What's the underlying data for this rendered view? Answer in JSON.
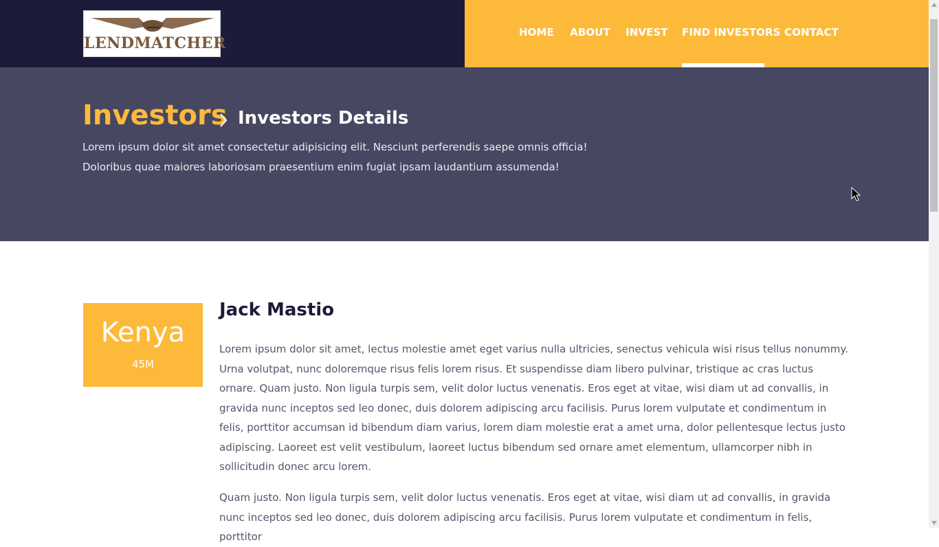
{
  "header": {
    "logo_text": "LENDMATCHER",
    "nav": [
      {
        "label": "HOME"
      },
      {
        "label": "ABOUT"
      },
      {
        "label": "INVEST"
      },
      {
        "label": "FIND INVESTORS",
        "active": true
      },
      {
        "label": "CONTACT"
      }
    ]
  },
  "banner": {
    "breadcrumb_main": "Investors",
    "breadcrumb_sub": "Investors Details",
    "description": "Lorem ipsum dolor sit amet consectetur adipisicing elit. Nesciunt perferendis saepe omnis officia! Doloribus quae maiores laboriosam praesentium enim fugiat ipsam laudantium assumenda!"
  },
  "investor": {
    "country": "Kenya",
    "amount": "45M",
    "name": "Jack Mastio",
    "paragraphs": [
      "Lorem ipsum dolor sit amet, lectus molestie amet eget varius nulla ultricies, senectus vehicula wisi risus tellus nonummy. Urna volutpat, nunc doloremque risus felis lorem risus. Et suspendisse diam libero pulvinar, tristique ac cras luctus ornare. Quam justo. Non ligula turpis sem, velit dolor luctus venenatis. Eros eget at vitae, wisi diam ut ad convallis, in gravida nunc inceptos sed leo donec, duis dolorem adipiscing arcu facilisis. Purus lorem vulputate et condimentum in felis, porttitor accumsan id bibendum diam varius, lorem diam molestie erat a amet urna, dolor pellentesque lectus justo adipiscing. Laoreet est velit vestibulum, laoreet luctus bibendum sed ornare amet elementum, ullamcorper nibh in sollicitudin donec arcu lorem.",
      "Quam justo. Non ligula turpis sem, velit dolor luctus venenatis. Eros eget at vitae, wisi diam ut ad convallis, in gravida nunc inceptos sed leo donec, duis dolorem adipiscing arcu facilisis. Purus lorem vulputate et condimentum in felis, porttitor"
    ]
  },
  "colors": {
    "header_dark": "#1c1c3a",
    "accent": "#fdba3a",
    "banner_bg": "#474761",
    "heading_text": "#1c1c3a",
    "body_text": "#55556a"
  },
  "icons": {
    "logo": "handshake-logo",
    "breadcrumb_separator": "chevron-right-icon",
    "cursor": "mouse-pointer-icon"
  }
}
